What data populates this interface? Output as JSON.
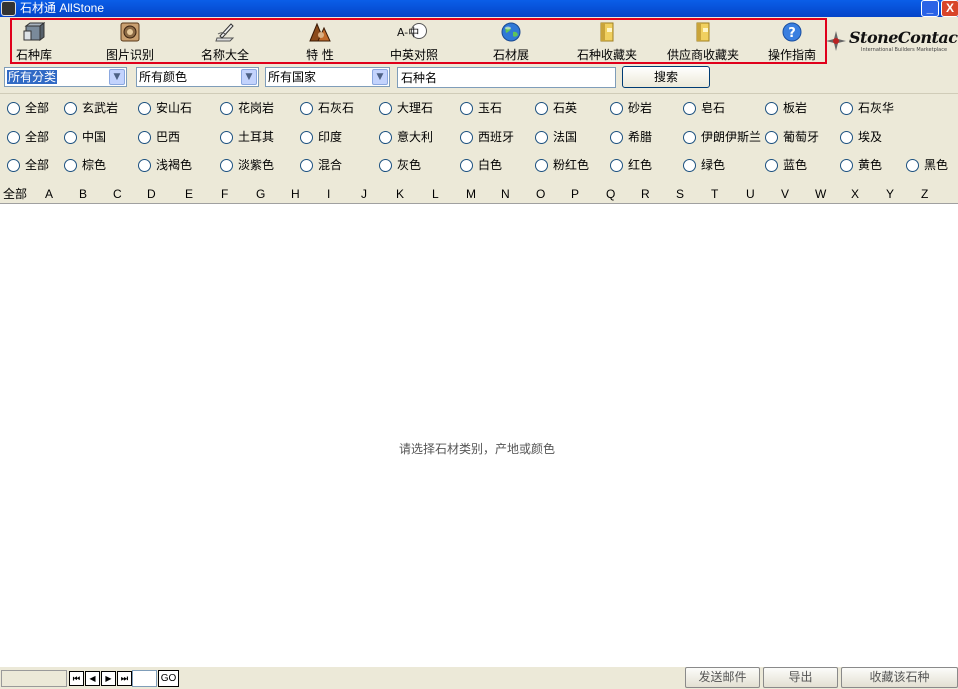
{
  "window": {
    "title": "石材通 AllStone",
    "minimize": "_",
    "close": "X"
  },
  "toolbar": {
    "items": [
      {
        "label": "石种库",
        "icon": "stone-library-icon"
      },
      {
        "label": "图片识别",
        "icon": "image-recognition-icon"
      },
      {
        "label": "名称大全",
        "icon": "name-dictionary-icon"
      },
      {
        "label": "特  性",
        "icon": "characteristics-icon"
      },
      {
        "label": "中英对照",
        "icon": "chinese-english-icon"
      },
      {
        "label": "石材展",
        "icon": "globe-icon"
      },
      {
        "label": "石种收藏夹",
        "icon": "stone-favorites-icon"
      },
      {
        "label": "供应商收藏夹",
        "icon": "supplier-favorites-icon"
      },
      {
        "label": "操作指南",
        "icon": "help-icon"
      }
    ],
    "icon_glyphs": {
      "chinese_english": "A-中",
      "help": "?"
    },
    "accent_color": "#e0001b"
  },
  "logo": {
    "brand": "StoneContact",
    "tagline": "International Builders Marketplace"
  },
  "filters": {
    "category": "所有分类",
    "color": "所有颜色",
    "country": "所有国家",
    "name_value": "石种名",
    "search_label": "搜索"
  },
  "options": {
    "categories": [
      "全部",
      "玄武岩",
      "安山石",
      "花岗岩",
      "石灰石",
      "大理石",
      "玉石",
      "石英",
      "砂岩",
      "皂石",
      "板岩",
      "石灰华"
    ],
    "countries": [
      "全部",
      "中国",
      "巴西",
      "土耳其",
      "印度",
      "意大利",
      "西班牙",
      "法国",
      "希腊",
      "伊朗伊斯兰",
      "葡萄牙",
      "埃及"
    ],
    "colors": [
      "全部",
      "棕色",
      "浅褐色",
      "淡紫色",
      "混合",
      "灰色",
      "白色",
      "粉红色",
      "红色",
      "绿色",
      "蓝色",
      "黄色",
      "黑色"
    ]
  },
  "alphabet": [
    "全部",
    "A",
    "B",
    "C",
    "D",
    "E",
    "F",
    "G",
    "H",
    "I",
    "J",
    "K",
    "L",
    "M",
    "N",
    "O",
    "P",
    "Q",
    "R",
    "S",
    "T",
    "U",
    "V",
    "W",
    "X",
    "Y",
    "Z"
  ],
  "empty_message": "请选择石材类别，产地或颜色",
  "pager": {
    "first": "⏮",
    "prev": "◀",
    "next": "▶",
    "last": "⏭",
    "go": "GO"
  },
  "actions": {
    "send_email": "发送邮件",
    "export": "导出",
    "favorite": "收藏该石种"
  }
}
